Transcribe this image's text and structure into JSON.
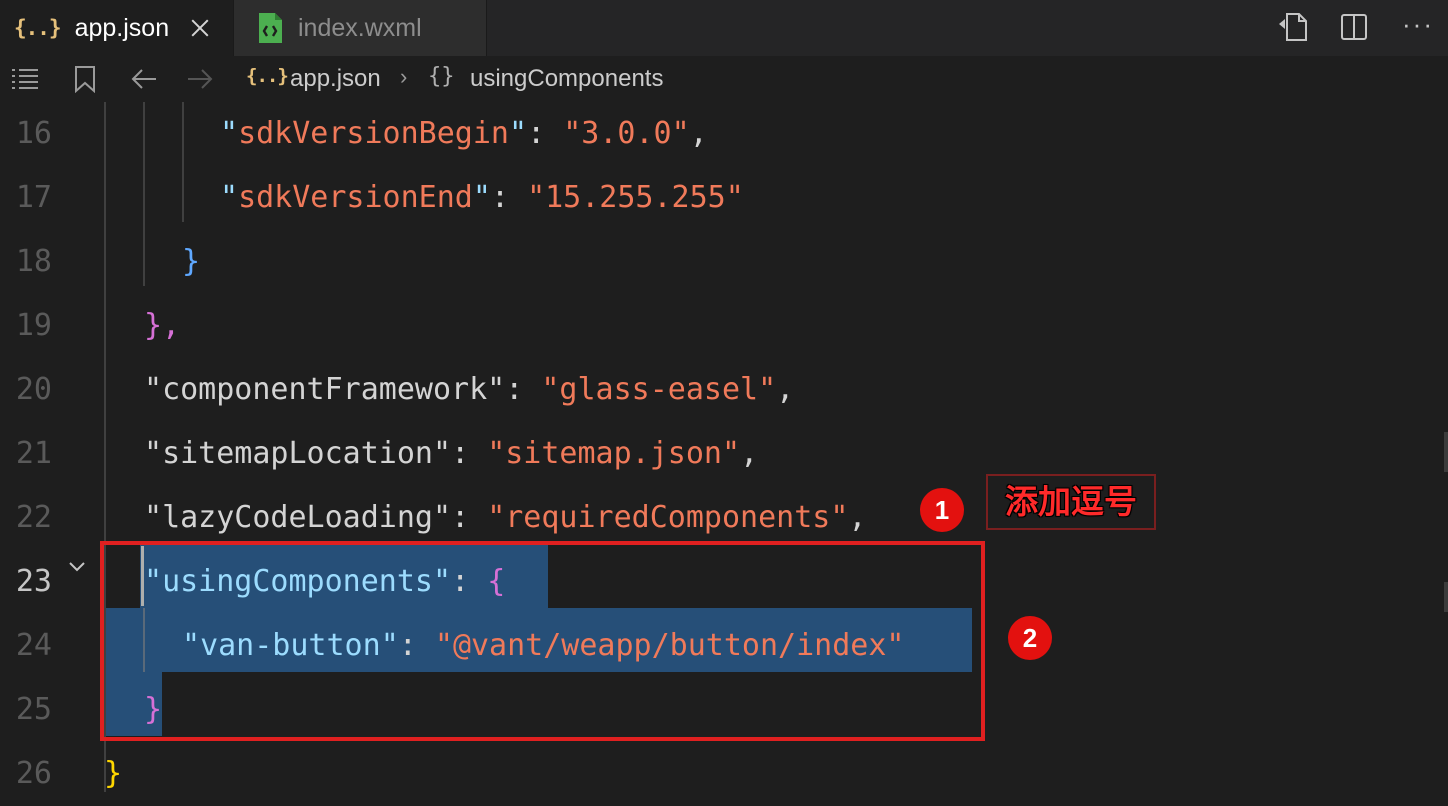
{
  "tabs": [
    {
      "icon": "{..}",
      "label": "app.json"
    },
    {
      "label": "index.wxml"
    }
  ],
  "breadcrumb": {
    "file_icon": "{..}",
    "file": "app.json",
    "separator": "›",
    "object_icon": "{}",
    "object": "usingComponents"
  },
  "editor": {
    "active_line": 23,
    "lines": [
      {
        "num": "16",
        "key": "sdkVersionBegin",
        "value": "3.0.0"
      },
      {
        "num": "17",
        "key": "sdkVersionEnd",
        "value": "15.255.255"
      },
      {
        "num": "18",
        "text": "}"
      },
      {
        "num": "19",
        "text": "},"
      },
      {
        "num": "20",
        "key": "componentFramework",
        "value": "glass-easel"
      },
      {
        "num": "21",
        "key": "sitemapLocation",
        "value": "sitemap.json"
      },
      {
        "num": "22",
        "key": "lazyCodeLoading",
        "value": "requiredComponents"
      },
      {
        "num": "23",
        "key": "usingComponents",
        "text": "{"
      },
      {
        "num": "24",
        "key": "van-button",
        "value": "@vant/weapp/button/index"
      },
      {
        "num": "25",
        "text": "}"
      },
      {
        "num": "26",
        "text": "}"
      }
    ]
  },
  "annotations": {
    "badge1": "1",
    "badge2": "2",
    "note": "添加逗号"
  },
  "colors": {
    "string": "#f07a5a",
    "key_quote": "#9cdcfe",
    "selection": "#264f78",
    "annotation_red": "#e3110f"
  }
}
